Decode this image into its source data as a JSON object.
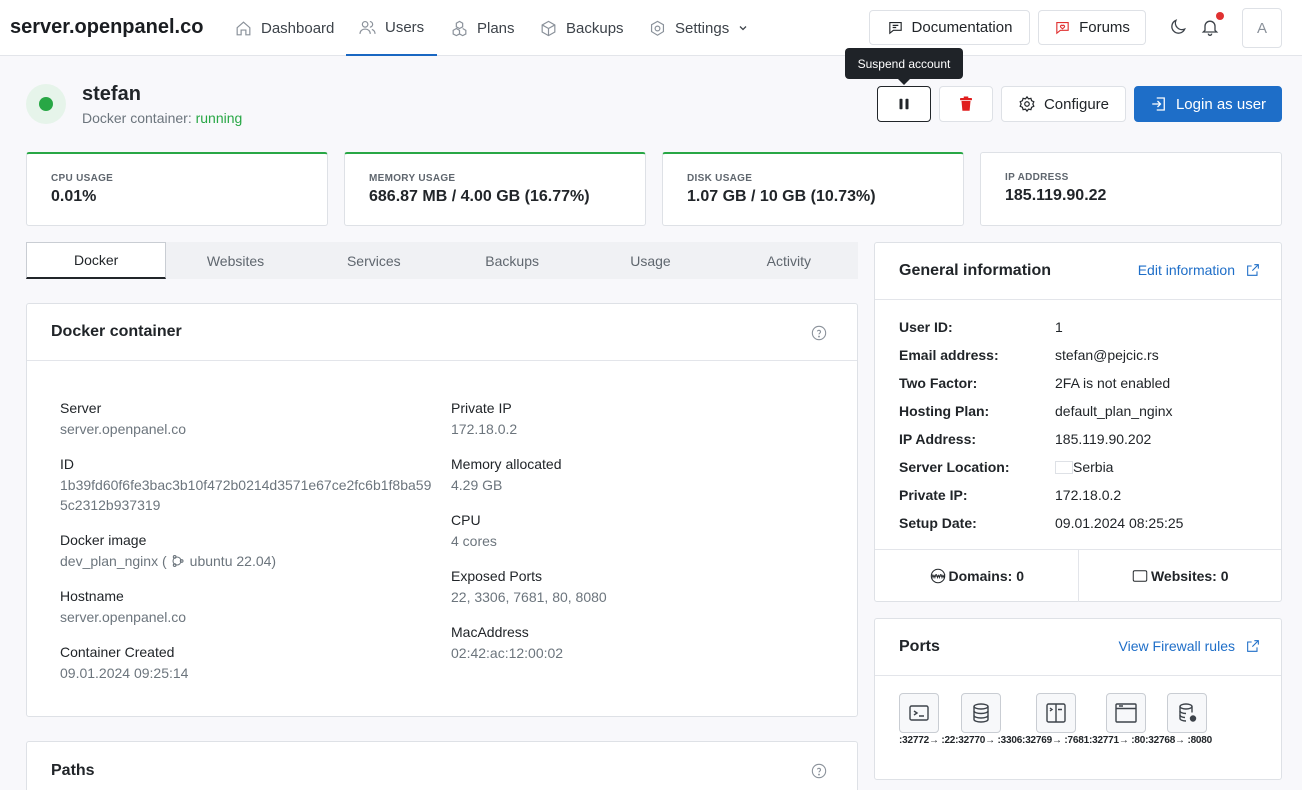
{
  "brand": "server.openpanel.co",
  "nav": [
    {
      "label": "Dashboard",
      "icon": "home-icon"
    },
    {
      "label": "Users",
      "icon": "users-icon"
    },
    {
      "label": "Plans",
      "icon": "plans-icon"
    },
    {
      "label": "Backups",
      "icon": "box-icon"
    },
    {
      "label": "Settings",
      "icon": "settings-icon"
    }
  ],
  "header_buttons": {
    "documentation": "Documentation",
    "forums": "Forums",
    "avatar": "A"
  },
  "user": {
    "name": "stefan",
    "container_label": "Docker container:",
    "container_status": "running"
  },
  "tooltip": "Suspend account",
  "actions": {
    "configure": "Configure",
    "login": "Login as user"
  },
  "stats": [
    {
      "label": "CPU USAGE",
      "value": "0.01%"
    },
    {
      "label": "MEMORY USAGE",
      "value": "686.87 MB / 4.00 GB (16.77%)"
    },
    {
      "label": "DISK USAGE",
      "value": "1.07 GB / 10 GB (10.73%)"
    },
    {
      "label": "IP ADDRESS",
      "value": "185.119.90.22"
    }
  ],
  "tabs": [
    "Docker",
    "Websites",
    "Services",
    "Backups",
    "Usage",
    "Activity"
  ],
  "docker": {
    "title": "Docker container",
    "server_k": "Server",
    "server_v": "server.openpanel.co",
    "id_k": "ID",
    "id_v": "1b39fd60f6fe3bac3b10f472b0214d3571e67ce2fc6b1f8ba595c2312b937319",
    "image_k": "Docker image",
    "image_v": "dev_plan_nginx",
    "image_os": "ubuntu 22.04",
    "hostname_k": "Hostname",
    "hostname_v": "server.openpanel.co",
    "created_k": "Container Created",
    "created_v": "09.01.2024 09:25:14",
    "privip_k": "Private IP",
    "privip_v": "172.18.0.2",
    "mem_k": "Memory allocated",
    "mem_v": "4.29 GB",
    "cpu_k": "CPU",
    "cpu_v": "4 cores",
    "ports_k": "Exposed Ports",
    "ports_v": "22, 3306, 7681, 80, 8080",
    "mac_k": "MacAddress",
    "mac_v": "02:42:ac:12:00:02"
  },
  "paths": {
    "title": "Paths"
  },
  "general": {
    "title": "General information",
    "edit": "Edit information",
    "rows": [
      {
        "k": "User ID:",
        "v": "1"
      },
      {
        "k": "Email address:",
        "v": "stefan@pejcic.rs"
      },
      {
        "k": "Two Factor:",
        "v": "2FA is not enabled"
      },
      {
        "k": "Hosting Plan:",
        "v": "default_plan_nginx"
      },
      {
        "k": "IP Address:",
        "v": "185.119.90.202"
      },
      {
        "k": "Server Location:",
        "v": "Serbia"
      },
      {
        "k": "Private IP:",
        "v": "172.18.0.2"
      },
      {
        "k": "Setup Date:",
        "v": "09.01.2024 08:25:25"
      }
    ],
    "domains": "Domains: 0",
    "websites": "Websites: 0"
  },
  "ports": {
    "title": "Ports",
    "firewall": "View Firewall rules",
    "mappings": ":32772→ :22:32770→ :3306:32769→ :7681:32771→ :80:32768→ :8080"
  }
}
